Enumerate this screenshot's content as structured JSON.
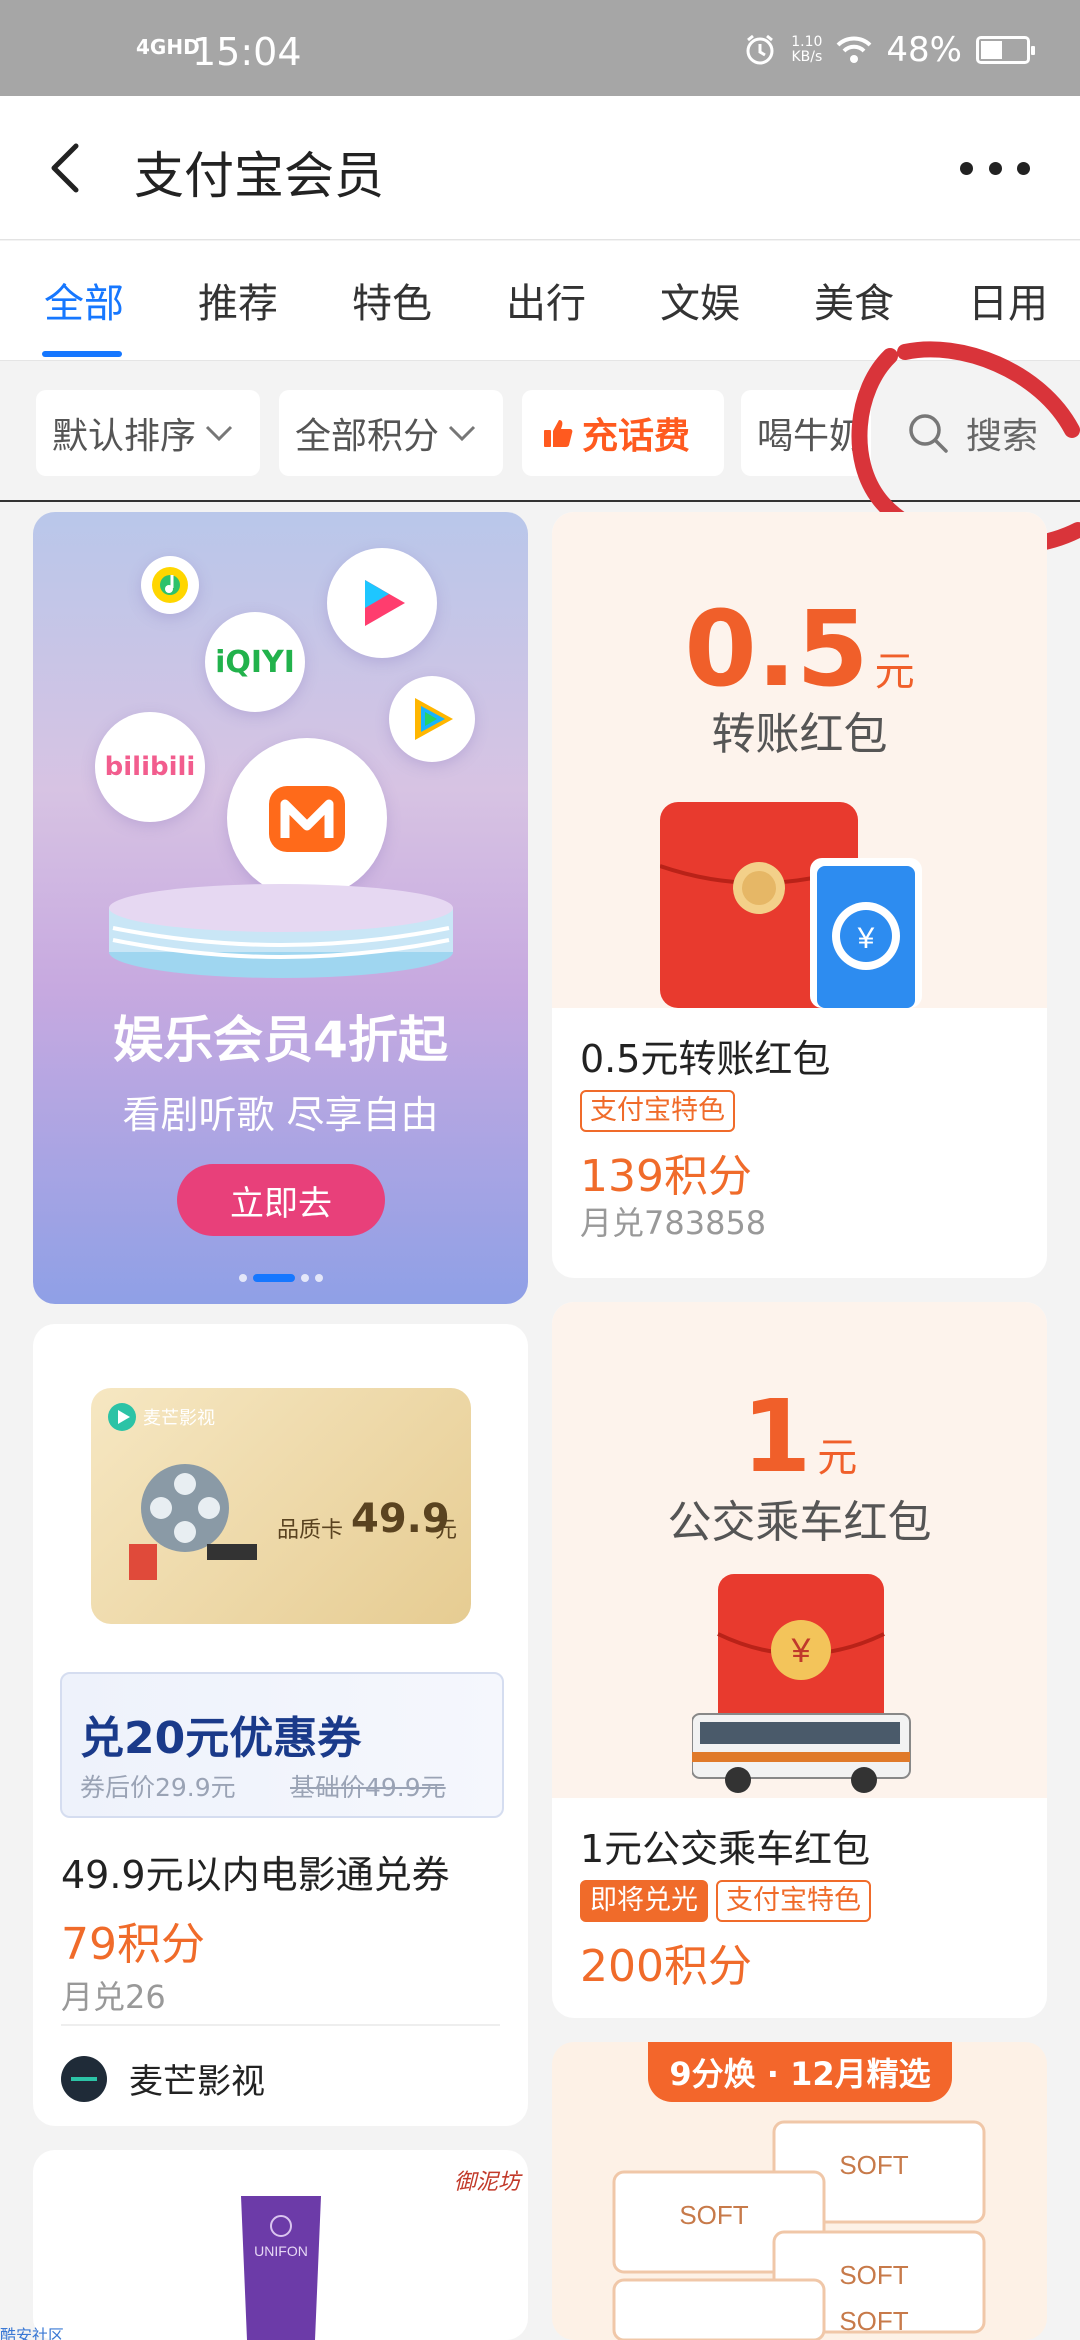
{
  "status_bar": {
    "network": "4GHD",
    "time": "15:04",
    "speed_value": "1.10",
    "speed_unit": "KB/s",
    "battery": "48%",
    "battery_level": 0.48
  },
  "header": {
    "title": "支付宝会员"
  },
  "tabs": [
    {
      "label": "全部",
      "active": true
    },
    {
      "label": "推荐"
    },
    {
      "label": "特色"
    },
    {
      "label": "出行"
    },
    {
      "label": "文娱"
    },
    {
      "label": "美食"
    },
    {
      "label": "日用"
    }
  ],
  "filters": {
    "sort": "默认排序",
    "points": "全部积分",
    "recharge": "充话费",
    "partial": "喝牛奶",
    "search": "搜索"
  },
  "banner": {
    "headline": "娱乐会员4折起",
    "subtitle": "看剧听歌 尽享自由",
    "cta": "立即去",
    "logo_iqiyi": "iQIYI",
    "logo_bilibili": "bilibili"
  },
  "products": [
    {
      "amount": "0.5",
      "unit": "元",
      "amount_label": "转账红包",
      "title": "0.5元转账红包",
      "tags": [
        "支付宝特色"
      ],
      "price": "139积分",
      "sold": "月兑783858"
    },
    {
      "card_brand": "麦芒影视",
      "card_label": "品质卡",
      "card_price": "49.9",
      "card_unit": "元",
      "coupon_title": "兑20元优惠券",
      "coupon_after": "券后价29.9元",
      "coupon_base": "基础价49.9元",
      "title": "49.9元以内电影通兑券",
      "price": "79积分",
      "sold": "月兑26",
      "merchant": "麦芒影视"
    },
    {
      "amount": "1",
      "unit": "元",
      "amount_label": "公交乘车红包",
      "title": "1元公交乘车红包",
      "tags": [
        "即将兑光",
        "支付宝特色"
      ],
      "price": "200积分"
    },
    {
      "badge": "9分焕 · 12月精选",
      "product_text": "SOFT"
    },
    {
      "brand_mark": "御泥坊",
      "bottle_text": "UNIFON"
    }
  ],
  "watermark": "酷安社区",
  "colors": {
    "accent_blue": "#1677ff",
    "price_orange": "#f06b2a",
    "annotation_red": "#d9343a"
  }
}
